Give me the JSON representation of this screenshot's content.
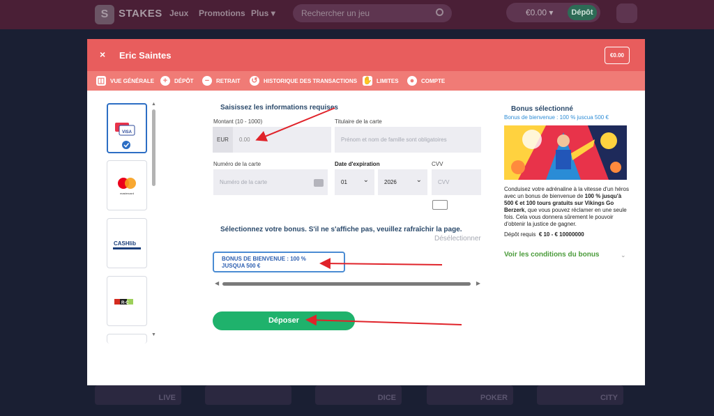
{
  "site": {
    "brand": "STAKES",
    "logo_letter": "S",
    "nav": [
      "Jeux",
      "Promotions",
      "Plus"
    ],
    "search_placeholder": "Rechercher un jeu",
    "balance": "€0.00",
    "deposit_label": "Dépôt"
  },
  "tiles": [
    "LIVE",
    "",
    "DICE",
    "POKER",
    "CITY"
  ],
  "modal": {
    "close": "×",
    "title": "Eric Saintes",
    "balance_badge": "€0.00",
    "tabs": [
      {
        "label": "VUE GÉNÉRALE",
        "icon": "wallet-icon"
      },
      {
        "label": "DÉPÔT",
        "icon": "plus-circle-icon"
      },
      {
        "label": "RETRAIT",
        "icon": "minus-circle-icon"
      },
      {
        "label": "HISTORIQUE DES TRANSACTIONS",
        "icon": "history-icon"
      },
      {
        "label": "LIMITES",
        "icon": "hand-icon"
      },
      {
        "label": "COMPTE",
        "icon": "user-icon"
      }
    ]
  },
  "payment_methods": [
    {
      "name": "VISA",
      "selected": true
    },
    {
      "name": "mastercard",
      "selected": false
    },
    {
      "name": "CASHlib",
      "selected": false
    },
    {
      "name": "R-C",
      "selected": false
    }
  ],
  "form": {
    "heading": "Saisissez les informations requises",
    "amount_label": "Montant (10 - 1000)",
    "currency": "EUR",
    "amount_value": "0.00",
    "holder_label": "Titulaire de la carte",
    "holder_placeholder": "Prénom et nom de famille sont obligatoires",
    "card_label": "Numéro de la carte",
    "card_placeholder": "Numéro de la carte",
    "expiry_label": "Date d'expiration",
    "expiry_month": "01",
    "expiry_year": "2026",
    "cvv_label": "CVV",
    "cvv_placeholder": "CVV"
  },
  "bonus_select": {
    "heading": "Sélectionnez votre bonus. S'il ne s'affiche pas, veuillez rafraîchir la page.",
    "deselect": "Désélectionner",
    "card_line1": "BONUS DE BIENVENUE : 100 %",
    "card_line2": "JUSQUA 500 €"
  },
  "submit_label": "Déposer",
  "bonus_panel": {
    "title": "Bonus sélectionné",
    "subtitle": "Bonus de bienvenue : 100 % juscua 500 €",
    "text_before": "Conduisez votre adrénaline à la vitesse d'un héros avec un bonus de bienvenue de ",
    "text_bold1": "100 % jusqu'à 500 € et 100 tours gratuits sur Vikings Go Berzerk",
    "text_after": ", que vous pouvez réclamer en une seule fois. Cela vous donnera sûrement le pouvoir d'obtenir la justice de gagner.",
    "req_label": "Dépôt requis",
    "req_value": "€ 10   - € 10000000",
    "link": "Voir les conditions du bonus"
  },
  "colors": {
    "header_red": "#e85d5d",
    "tabs_red": "#f07b76",
    "green": "#1fb26c",
    "blue_select": "#4a8bd3",
    "arrow_red": "#e0232a"
  }
}
